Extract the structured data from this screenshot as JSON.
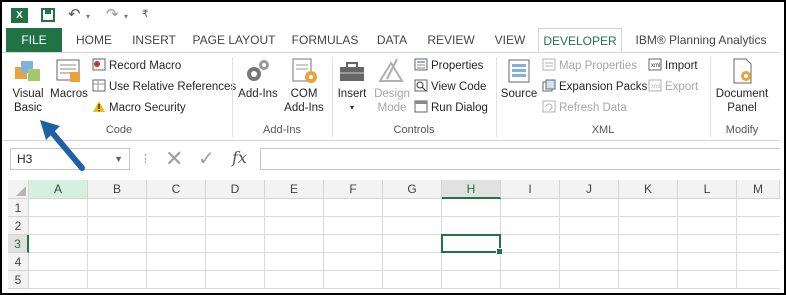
{
  "tabs": {
    "file": "FILE",
    "items": [
      "HOME",
      "INSERT",
      "PAGE LAYOUT",
      "FORMULAS",
      "DATA",
      "REVIEW",
      "VIEW",
      "DEVELOPER",
      "IBM® Planning Analytics"
    ],
    "active": "DEVELOPER"
  },
  "ribbon": {
    "code": {
      "label": "Code",
      "visual_basic": [
        "Visual",
        "Basic"
      ],
      "macros": "Macros",
      "record_macro": "Record Macro",
      "relative_refs": "Use Relative References",
      "macro_security": "Macro Security"
    },
    "addins": {
      "label": "Add-Ins",
      "addins": "Add-Ins",
      "com_addins": [
        "COM",
        "Add-Ins"
      ]
    },
    "controls": {
      "label": "Controls",
      "insert": "Insert",
      "design_mode": [
        "Design",
        "Mode"
      ],
      "properties": "Properties",
      "view_code": "View Code",
      "run_dialog": "Run Dialog"
    },
    "xml": {
      "label": "XML",
      "source": "Source",
      "map_properties": "Map Properties",
      "expansion_packs": "Expansion Packs",
      "refresh_data": "Refresh Data",
      "import": "Import",
      "export": "Export"
    },
    "modify": {
      "label": "Modify",
      "document_panel": [
        "Document",
        "Panel"
      ]
    }
  },
  "formula_bar": {
    "name_box": "H3",
    "fx": "fx",
    "value": ""
  },
  "grid": {
    "columns": [
      "A",
      "B",
      "C",
      "D",
      "E",
      "F",
      "G",
      "H",
      "I",
      "J",
      "K",
      "L",
      "M"
    ],
    "rows": [
      "1",
      "2",
      "3",
      "4",
      "5"
    ],
    "active_column": "H",
    "active_row": "3"
  },
  "colors": {
    "excel_green": "#217346",
    "arrow_blue": "#1f5fa8"
  }
}
